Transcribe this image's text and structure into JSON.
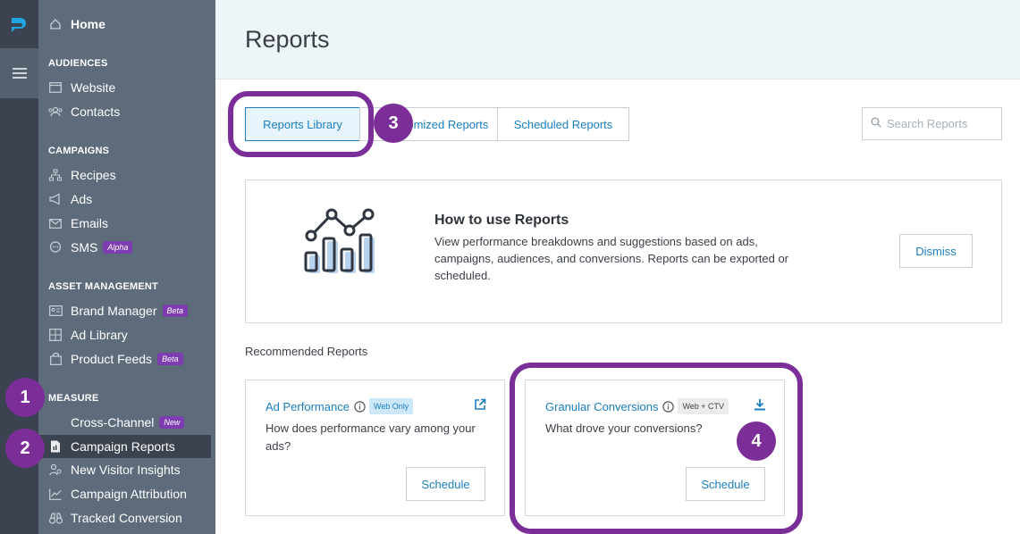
{
  "sidebar": {
    "home": "Home",
    "sections": {
      "audiences": "AUDIENCES",
      "campaigns": "CAMPAIGNS",
      "asset_management": "ASSET MANAGEMENT",
      "measure": "MEASURE"
    },
    "items": {
      "website": "Website",
      "contacts": "Contacts",
      "recipes": "Recipes",
      "ads": "Ads",
      "emails": "Emails",
      "sms": "SMS",
      "sms_tag": "Alpha",
      "brand_manager": "Brand Manager",
      "brand_manager_tag": "Beta",
      "ad_library": "Ad Library",
      "product_feeds": "Product Feeds",
      "product_feeds_tag": "Beta",
      "cross_channel": "Cross-Channel",
      "cross_channel_tag": "New",
      "campaign_reports": "Campaign Reports",
      "new_visitor_insights": "New Visitor Insights",
      "campaign_attribution": "Campaign Attribution",
      "tracked_conversion": "Tracked Conversion"
    }
  },
  "header": {
    "title": "Reports"
  },
  "tabs": {
    "library": "Reports Library",
    "customized": "Customized Reports",
    "scheduled": "Scheduled Reports"
  },
  "search": {
    "placeholder": "Search Reports"
  },
  "howto": {
    "title": "How to use Reports",
    "body": "View performance breakdowns and suggestions based on ads, campaigns, audiences, and conversions. Reports can be exported or scheduled.",
    "dismiss": "Dismiss"
  },
  "recommended": {
    "label": "Recommended Reports",
    "cards": [
      {
        "title": "Ad Performance",
        "badge": "Web Only",
        "desc": "How does performance vary among your ads?",
        "action": "Schedule"
      },
      {
        "title": "Granular Conversions",
        "badge": "Web + CTV",
        "desc": "What drove your conversions?",
        "action": "Schedule"
      }
    ]
  },
  "annotations": {
    "n1": "1",
    "n2": "2",
    "n3": "3",
    "n4": "4"
  },
  "colors": {
    "accent": "#1a7fc1",
    "annotation": "#7b2e98",
    "sidebar": "#5d6b7b",
    "rail": "#3b4350"
  }
}
